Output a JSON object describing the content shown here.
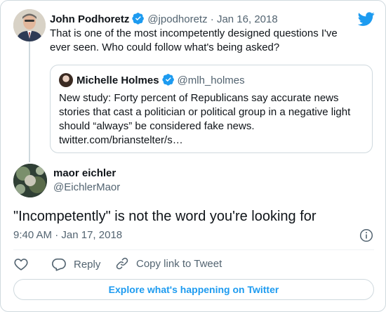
{
  "brand": {
    "accent": "#1d9bf0",
    "icon": "twitter-bird-icon"
  },
  "parent_tweet": {
    "name": "John Podhoretz",
    "handle": "@jpodhoretz",
    "separator": "·",
    "date": "Jan 16, 2018",
    "text": "That is one of the most incompetently designed questions I've ever seen. Who could  follow what's being asked?"
  },
  "quoted_tweet": {
    "name": "Michelle Holmes",
    "handle": "@mlh_holmes",
    "text": "New study: Forty percent of Republicans say accurate news stories that cast a politician or political group in a negative light should “always” be considered fake news. twitter.com/brianstelter/s…"
  },
  "main_tweet": {
    "name": "maor eichler",
    "handle": "@EichlerMaor",
    "text": "\"Incompetently\" is not the word you're looking for",
    "time": "9:40 AM",
    "separator": "·",
    "date": "Jan 17, 2018"
  },
  "actions": {
    "like_icon": "heart-icon",
    "reply_label": "Reply",
    "copy_label": "Copy link to Tweet"
  },
  "explore_label": "Explore what's happening on Twitter"
}
